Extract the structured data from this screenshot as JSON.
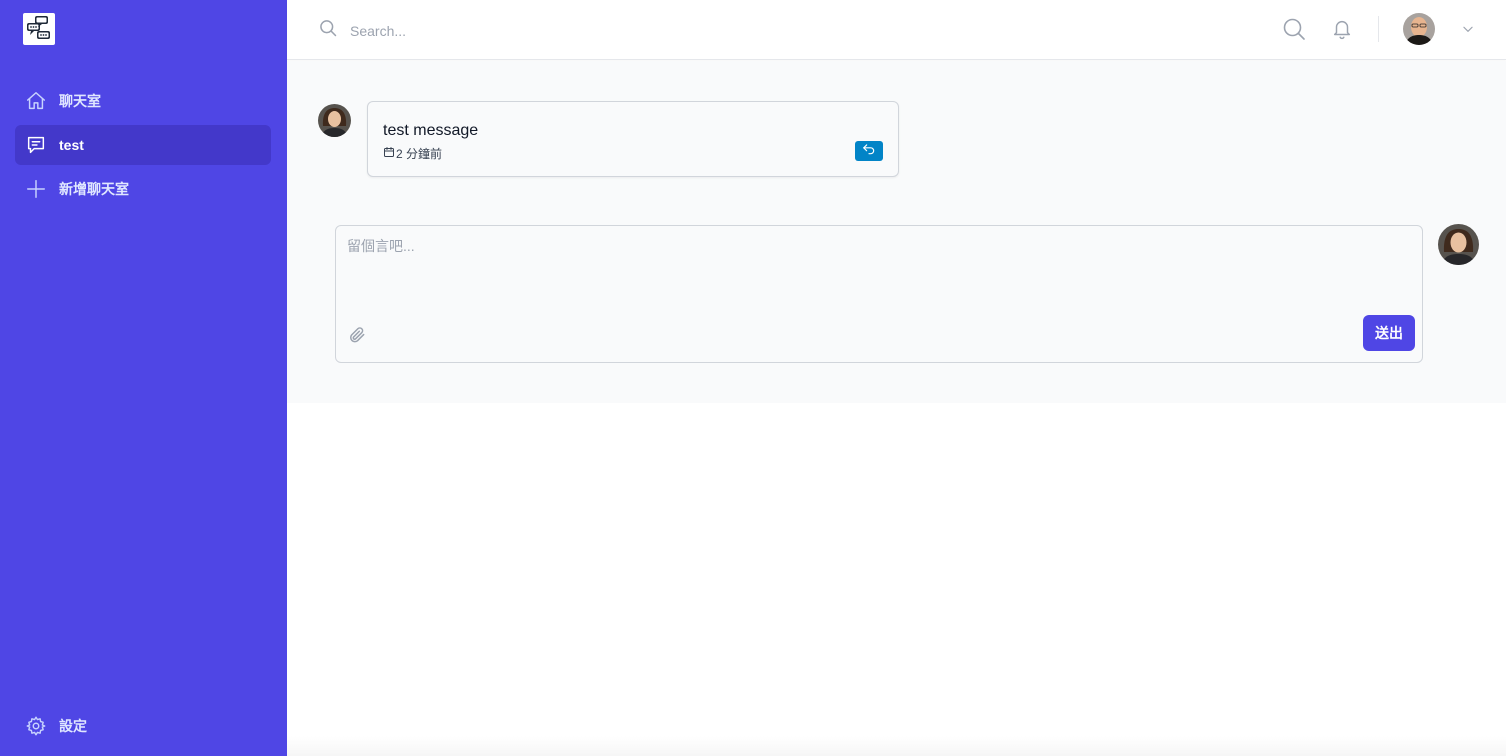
{
  "sidebar": {
    "items": [
      {
        "label": "聊天室",
        "icon": "home-icon"
      },
      {
        "label": "test",
        "icon": "chat-bubble-icon",
        "active": true
      },
      {
        "label": "新增聊天室",
        "icon": "plus-icon"
      }
    ],
    "settings_label": "設定"
  },
  "header": {
    "search_placeholder": "Search..."
  },
  "messages": [
    {
      "text": "test message",
      "time": "2 分鐘前"
    }
  ],
  "composer": {
    "placeholder": "留個言吧...",
    "send_label": "送出"
  },
  "colors": {
    "accent": "#4f46e5",
    "accent_dark": "#4338ca",
    "reply": "#0284c7"
  }
}
